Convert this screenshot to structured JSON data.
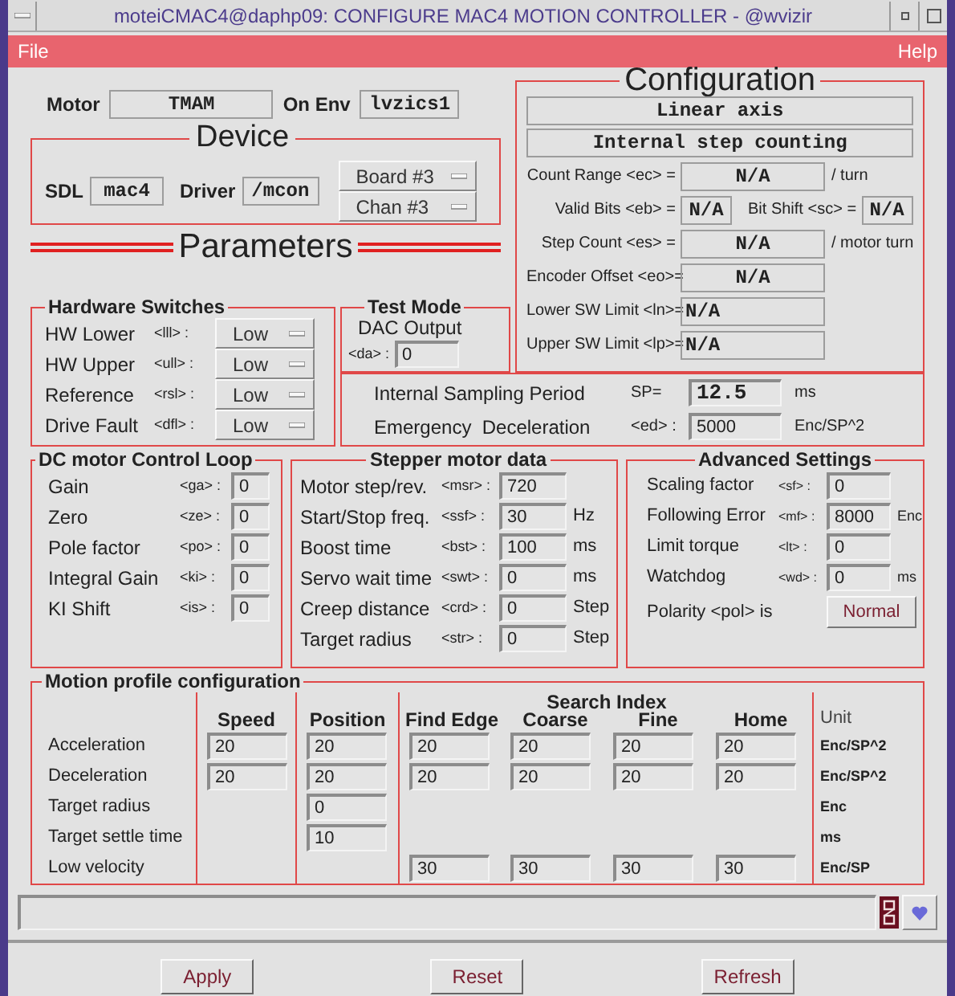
{
  "window": {
    "title": "moteiCMAC4@daphp09: CONFIGURE MAC4 MOTION CONTROLLER - @wvizir"
  },
  "menu": [
    {
      "label": "File"
    },
    {
      "label": "Help"
    }
  ],
  "motor": {
    "label": "Motor",
    "value": "TMAM",
    "env_label": "On Env",
    "env_value": "lvzics1"
  },
  "device": {
    "title": "Device",
    "sdl_label": "SDL",
    "sdl_value": "mac4",
    "driver_label": "Driver",
    "driver_value": "/mcon",
    "menus": [
      "Board #3",
      "Chan #3"
    ]
  },
  "parameters_heading": "Parameters",
  "configuration": {
    "title": "Configuration",
    "modes": [
      "Linear axis",
      "Internal step counting"
    ],
    "rows": [
      {
        "kind": "wide",
        "label": "Count Range <ec> =",
        "value": "N/A",
        "unit": "/ turn"
      },
      {
        "kind": "split",
        "label": "Valid Bits <eb> =",
        "value": "N/A",
        "label2": "Bit Shift <sc> =",
        "value2": "N/A"
      },
      {
        "kind": "wide",
        "label": "Step Count <es> =",
        "value": "N/A",
        "unit": "/ motor turn"
      },
      {
        "kind": "wide",
        "label": "Encoder Offset <eo>=",
        "value": "N/A"
      },
      {
        "kind": "limit",
        "label": "Lower SW Limit <ln>=",
        "value": "N/A"
      },
      {
        "kind": "limit",
        "label": "Upper SW Limit <lp>=",
        "value": "N/A"
      }
    ]
  },
  "hardware_switches": {
    "title": "Hardware Switches",
    "rows": [
      {
        "label": "HW Lower",
        "code": "<lll> :",
        "value": "Low"
      },
      {
        "label": "HW Upper",
        "code": "<ull> :",
        "value": "Low"
      },
      {
        "label": "Reference",
        "code": "<rsl> :",
        "value": "Low"
      },
      {
        "label": "Drive Fault",
        "code": "<dfl> :",
        "value": "Low"
      }
    ]
  },
  "test_mode": {
    "title": "Test Mode",
    "label": "DAC Output",
    "code": "<da> :",
    "value": "0"
  },
  "sampling": [
    {
      "label": "Internal Sampling Period",
      "code": "SP=",
      "value": "12.5",
      "unit": "ms"
    },
    {
      "label": "Emergency  Deceleration",
      "code": "<ed> :",
      "value": "5000",
      "unit": "Enc/SP^2"
    }
  ],
  "dc_loop": {
    "title": "DC motor Control Loop",
    "rows": [
      {
        "label": "Gain",
        "code": "<ga> :",
        "value": "0"
      },
      {
        "label": "Zero",
        "code": "<ze> :",
        "value": "0"
      },
      {
        "label": "Pole factor",
        "code": "<po> :",
        "value": "0"
      },
      {
        "label": "Integral Gain",
        "code": "<ki> :",
        "value": "0"
      },
      {
        "label": "KI Shift",
        "code": "<is> :",
        "value": "0"
      }
    ]
  },
  "stepper": {
    "title": "Stepper motor data",
    "rows": [
      {
        "label": "Motor step/rev.",
        "code": "<msr> :",
        "value": "720"
      },
      {
        "label": "Start/Stop freq.",
        "code": "<ssf> :",
        "value": "30",
        "unit": "Hz"
      },
      {
        "label": "Boost time",
        "code": "<bst> :",
        "value": "100",
        "unit": "ms"
      },
      {
        "label": "Servo wait time",
        "code": "<swt> :",
        "value": "0",
        "unit": "ms"
      },
      {
        "label": "Creep distance",
        "code": "<crd> :",
        "value": "0",
        "unit": "Step"
      },
      {
        "label": "Target radius",
        "code": "<str> :",
        "value": "0",
        "unit": "Step"
      }
    ]
  },
  "advanced": {
    "title": "Advanced Settings",
    "rows": [
      {
        "kind": "field",
        "label": "Scaling factor",
        "code": "<sf> :",
        "value": "0"
      },
      {
        "kind": "field",
        "label": "Following Error",
        "code": "<mf> :",
        "value": "8000",
        "unit": "Enc"
      },
      {
        "kind": "field",
        "label": "Limit torque",
        "code": "<lt> :",
        "value": "0"
      },
      {
        "kind": "field",
        "label": "Watchdog",
        "code": "<wd> :",
        "value": "0",
        "unit": "ms"
      },
      {
        "kind": "toggle",
        "label": "Polarity <pol> is",
        "value": "Normal"
      }
    ]
  },
  "motion_profile": {
    "title": "Motion profile configuration",
    "group_header": "Search Index",
    "columns": [
      "Speed",
      "Position",
      "Find Edge",
      "Coarse",
      "Fine",
      "Home"
    ],
    "unit_header": "Unit",
    "rows": [
      {
        "label": "Acceleration",
        "cells": [
          "20",
          "20",
          "20",
          "20",
          "20",
          "20"
        ],
        "unit": "Enc/SP^2"
      },
      {
        "label": "Deceleration",
        "cells": [
          "20",
          "20",
          "20",
          "20",
          "20",
          "20"
        ],
        "unit": "Enc/SP^2"
      },
      {
        "label": "Target radius",
        "cells": [
          null,
          "0",
          null,
          null,
          null,
          null
        ],
        "unit": "Enc"
      },
      {
        "label": "Target settle time",
        "cells": [
          null,
          "10",
          null,
          null,
          null,
          null
        ],
        "unit": "ms"
      },
      {
        "label": "Low velocity",
        "cells": [
          null,
          null,
          "30",
          "30",
          "30",
          "30"
        ],
        "unit": "Enc/SP"
      }
    ]
  },
  "buttons": [
    "Apply",
    "Reset",
    "Refresh"
  ]
}
